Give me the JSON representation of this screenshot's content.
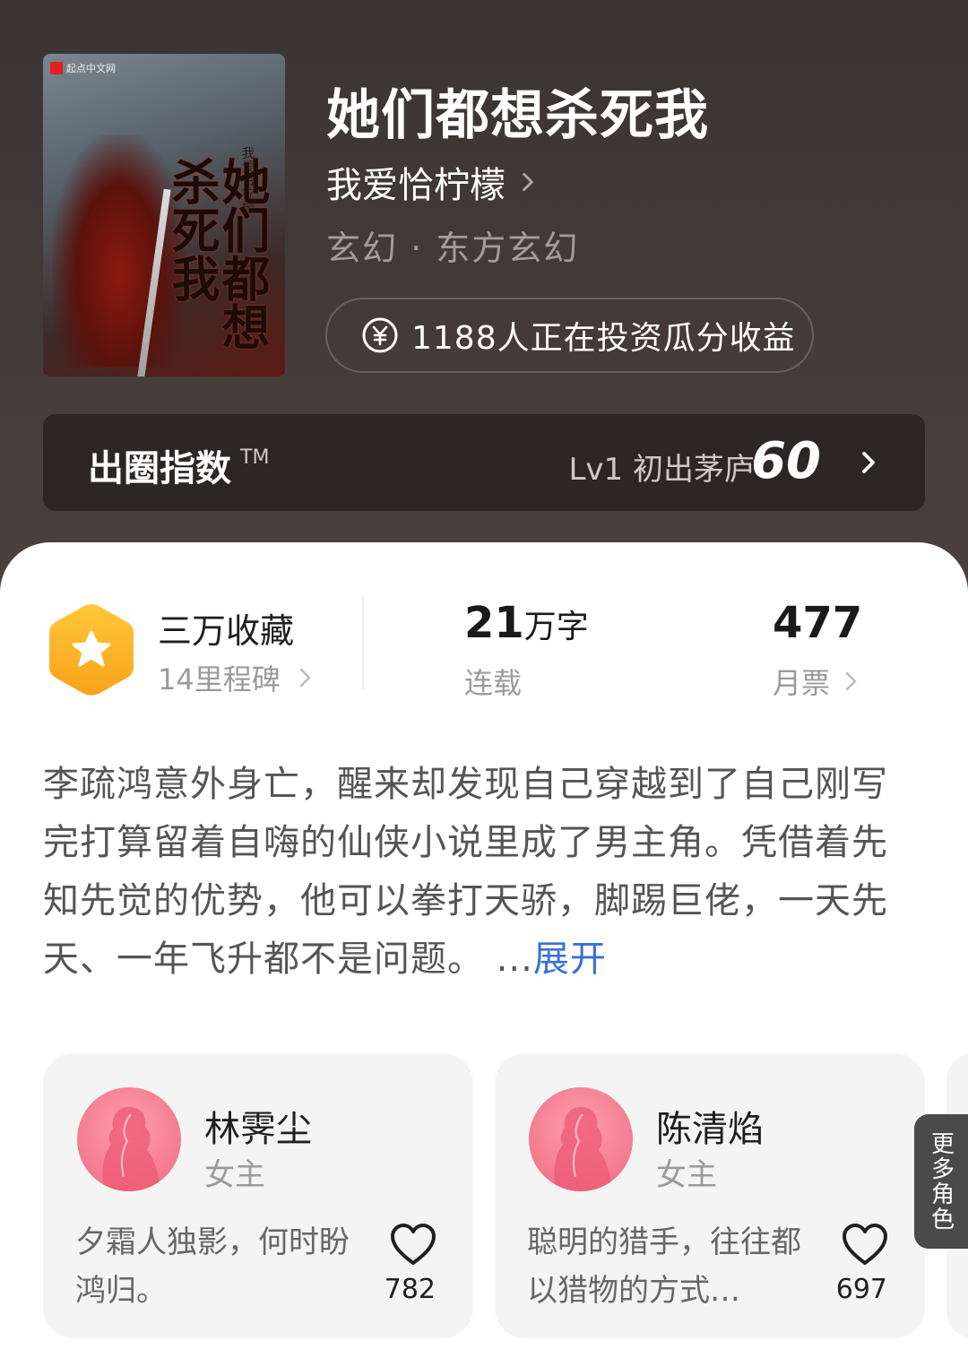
{
  "book": {
    "title": "她们都想杀死我",
    "author": "我爱恰柠檬",
    "genre": "玄幻 · 东方玄幻",
    "invest_text": "1188人正在投资瓜分收益"
  },
  "cover": {
    "publisher": "起点中文网",
    "cover_title": "她们都想杀死我",
    "cover_author": "我爱恰柠檬"
  },
  "index": {
    "label": "出圈指数",
    "tm": "TM",
    "level": "Lv1 初出茅庐",
    "score": "60"
  },
  "stats": {
    "collect_title": "三万收藏",
    "collect_sub": "14里程碑",
    "words_num": "21",
    "words_unit": "万字",
    "words_sub": "连载",
    "votes_num": "477",
    "votes_sub": "月票"
  },
  "synopsis": {
    "text": "李疏鸿意外身亡，醒来却发现自己穿越到了自己刚写完打算留着自嗨的仙侠小说里成了男主角。凭借着先知先觉的优势，他可以拳打天骄，脚踢巨佬，一天先天、一年飞升都不是问题。 ...",
    "expand": "展开"
  },
  "characters": [
    {
      "name": "林霁尘",
      "role": "女主",
      "desc": "夕霜人独影，何时盼鸿归。",
      "likes": "782"
    },
    {
      "name": "陈清焰",
      "role": "女主",
      "desc": "聪明的猎手，往往都以猎物的方式…",
      "likes": "697"
    }
  ],
  "more_roles": "更多角色",
  "colors": {
    "header_bg": "#3a3433",
    "accent_link": "#3a6fd8",
    "badge_gold": "#fbb32a",
    "avatar_pink": "#f27a8e"
  },
  "icons": {
    "coin": "yen-coin-icon",
    "badge": "star-hexagon-icon",
    "heart": "heart-outline-icon",
    "chevron": "chevron-right-icon"
  }
}
